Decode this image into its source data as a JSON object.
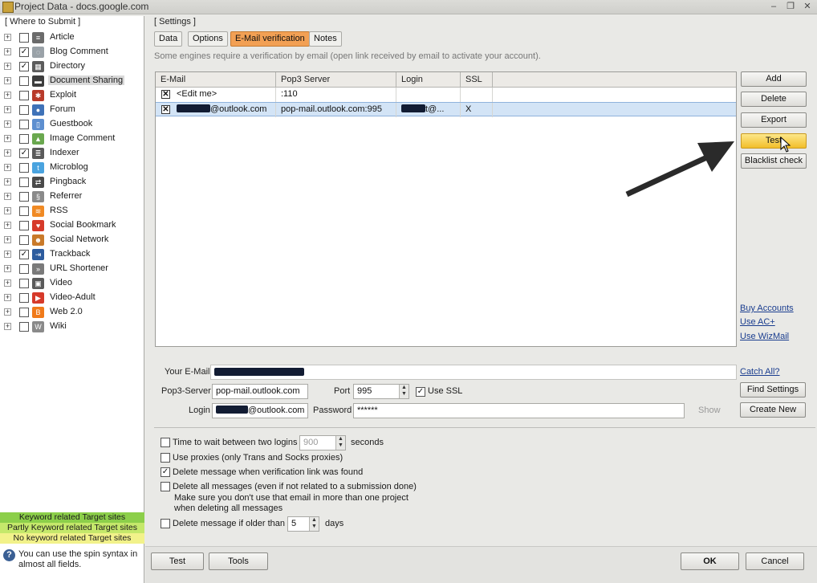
{
  "window": {
    "title": "Project Data - docs.google.com"
  },
  "left_panel": {
    "legend": "[ Where to Submit ]",
    "items": [
      {
        "label": "Article",
        "checked": false,
        "icon": "article-icon",
        "color": "#6b6b6b",
        "glyph": "≡"
      },
      {
        "label": "Blog Comment",
        "checked": true,
        "icon": "comment-icon",
        "color": "#9aa2a8",
        "glyph": "◌"
      },
      {
        "label": "Directory",
        "checked": true,
        "icon": "directory-icon",
        "color": "#5c5c5c",
        "glyph": "▦"
      },
      {
        "label": "Document Sharing",
        "checked": false,
        "icon": "folder-icon",
        "color": "#3d3d3d",
        "glyph": "▬",
        "selected": true
      },
      {
        "label": "Exploit",
        "checked": false,
        "icon": "bug-icon",
        "color": "#b83a2a",
        "glyph": "✱"
      },
      {
        "label": "Forum",
        "checked": false,
        "icon": "forum-icon",
        "color": "#3f72b8",
        "glyph": "●"
      },
      {
        "label": "Guestbook",
        "checked": false,
        "icon": "book-icon",
        "color": "#5d8fd0",
        "glyph": "▯"
      },
      {
        "label": "Image Comment",
        "checked": false,
        "icon": "image-icon",
        "color": "#6aa84f",
        "glyph": "▲"
      },
      {
        "label": "Indexer",
        "checked": true,
        "icon": "indexer-icon",
        "color": "#5a5a5a",
        "glyph": "≣"
      },
      {
        "label": "Microblog",
        "checked": false,
        "icon": "twitter-icon",
        "color": "#4aa3df",
        "glyph": "t"
      },
      {
        "label": "Pingback",
        "checked": false,
        "icon": "pingback-icon",
        "color": "#4a4a4a",
        "glyph": "⇄"
      },
      {
        "label": "Referrer",
        "checked": false,
        "icon": "referrer-icon",
        "color": "#8a8a8a",
        "glyph": "§"
      },
      {
        "label": "RSS",
        "checked": false,
        "icon": "rss-icon",
        "color": "#f08a24",
        "glyph": "≋"
      },
      {
        "label": "Social Bookmark",
        "checked": false,
        "icon": "heart-icon",
        "color": "#d63a2a",
        "glyph": "♥"
      },
      {
        "label": "Social Network",
        "checked": false,
        "icon": "people-icon",
        "color": "#c97a2a",
        "glyph": "☻"
      },
      {
        "label": "Trackback",
        "checked": true,
        "icon": "trackback-icon",
        "color": "#2d5c9e",
        "glyph": "⇥"
      },
      {
        "label": "URL Shortener",
        "checked": false,
        "icon": "chevrons-icon",
        "color": "#7a7a7a",
        "glyph": "»"
      },
      {
        "label": "Video",
        "checked": false,
        "icon": "film-icon",
        "color": "#5a5a5a",
        "glyph": "▣"
      },
      {
        "label": "Video-Adult",
        "checked": false,
        "icon": "play-icon",
        "color": "#d63a2a",
        "glyph": "▶"
      },
      {
        "label": "Web 2.0",
        "checked": false,
        "icon": "blogger-icon",
        "color": "#f07a1a",
        "glyph": "B"
      },
      {
        "label": "Wiki",
        "checked": false,
        "icon": "wiki-icon",
        "color": "#8a8a8a",
        "glyph": "W"
      }
    ],
    "legend_bars": [
      {
        "label": "Keyword related Target sites",
        "color": "#8ccf4a"
      },
      {
        "label": "Partly Keyword related Target sites",
        "color": "#c5e86b"
      },
      {
        "label": "No keyword related Target sites",
        "color": "#f2f28a"
      }
    ],
    "help_text": "You can use the spin syntax in almost all fields."
  },
  "settings": {
    "legend": "[ Settings ]",
    "tabs": [
      "Data",
      "Options",
      "E-Mail verification",
      "Notes"
    ],
    "info": "Some engines require a verification by email (open link received by email to activate your account).",
    "grid": {
      "columns": [
        "E-Mail",
        "Pop3 Server",
        "Login",
        "SSL"
      ],
      "rows": [
        {
          "email": "<Edit me>",
          "pop3": ":110",
          "login": "",
          "ssl": ""
        },
        {
          "email": "@outlook.com",
          "pop3": "pop-mail.outlook.com:995",
          "login": "t@...",
          "ssl": "X"
        }
      ]
    },
    "side_buttons": [
      "Add",
      "Delete",
      "Export",
      "Test",
      "Blacklist check"
    ],
    "links": [
      "Buy Accounts",
      "Use AC+",
      "Use WizMail"
    ],
    "form": {
      "your_email_label": "Your E-Mail",
      "catch_all": "Catch All?",
      "pop3_label": "Pop3-Server",
      "pop3_value": "pop-mail.outlook.com",
      "port_label": "Port",
      "port_value": "995",
      "use_ssl_label": "Use SSL",
      "find_settings": "Find Settings",
      "login_label": "Login",
      "login_value": "@outlook.com",
      "password_label": "Password",
      "password_value": "******",
      "show_label": "Show",
      "create_new": "Create New"
    },
    "options": {
      "wait_label": "Time to wait between two logins",
      "wait_value": "900",
      "wait_unit": "seconds",
      "proxies_label": "Use proxies (only Trans and Socks proxies)",
      "delete_found_label": "Delete message when verification link was found",
      "delete_all_label": "Delete all messages (even if not related to a submission done)",
      "delete_all_note1": "Make sure you don't use that email in more than one project",
      "delete_all_note2": "when deleting all messages",
      "delete_older_label": "Delete message if older than",
      "delete_older_value": "5",
      "delete_older_unit": "days"
    }
  },
  "footer": {
    "test": "Test",
    "tools": "Tools",
    "ok": "OK",
    "cancel": "Cancel"
  }
}
